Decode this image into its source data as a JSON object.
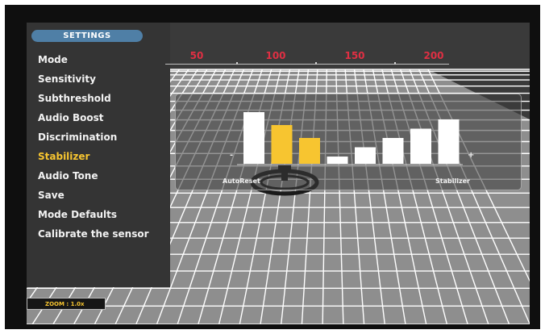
{
  "settings_title": "SETTINGS",
  "menu": {
    "items": [
      {
        "label": "Mode",
        "active": false
      },
      {
        "label": "Sensitivity",
        "active": false
      },
      {
        "label": "Subthreshold",
        "active": false
      },
      {
        "label": "Audio Boost",
        "active": false
      },
      {
        "label": "Discrimination",
        "active": false
      },
      {
        "label": "Stabilizer",
        "active": true
      },
      {
        "label": "Audio Tone",
        "active": false
      },
      {
        "label": "Save",
        "active": false
      },
      {
        "label": "Mode Defaults",
        "active": false
      },
      {
        "label": "Calibrate the sensor",
        "active": false
      }
    ]
  },
  "ruler": {
    "labels": [
      "50",
      "100",
      "150",
      "200"
    ]
  },
  "stabilizer_panel": {
    "minus": "-",
    "plus": "+",
    "left_label": "AutoReset",
    "right_label": "Stabilizer",
    "levels": [
      {
        "level": 1.0,
        "selected": false
      },
      {
        "level": 0.75,
        "selected": true
      },
      {
        "level": 0.5,
        "selected": true
      },
      {
        "level": 0.14,
        "selected": false
      },
      {
        "level": 0.32,
        "selected": false
      },
      {
        "level": 0.5,
        "selected": false
      },
      {
        "level": 0.68,
        "selected": false
      },
      {
        "level": 0.86,
        "selected": false
      }
    ]
  },
  "zoom": {
    "label": "ZOOM : 1.0x"
  },
  "colors": {
    "accent": "#f7c530",
    "ruler_label": "#e02f43",
    "title_bg": "#4f7fa6",
    "bar_default": "#ffffff"
  },
  "icons": [
    "search-coil-icon"
  ]
}
